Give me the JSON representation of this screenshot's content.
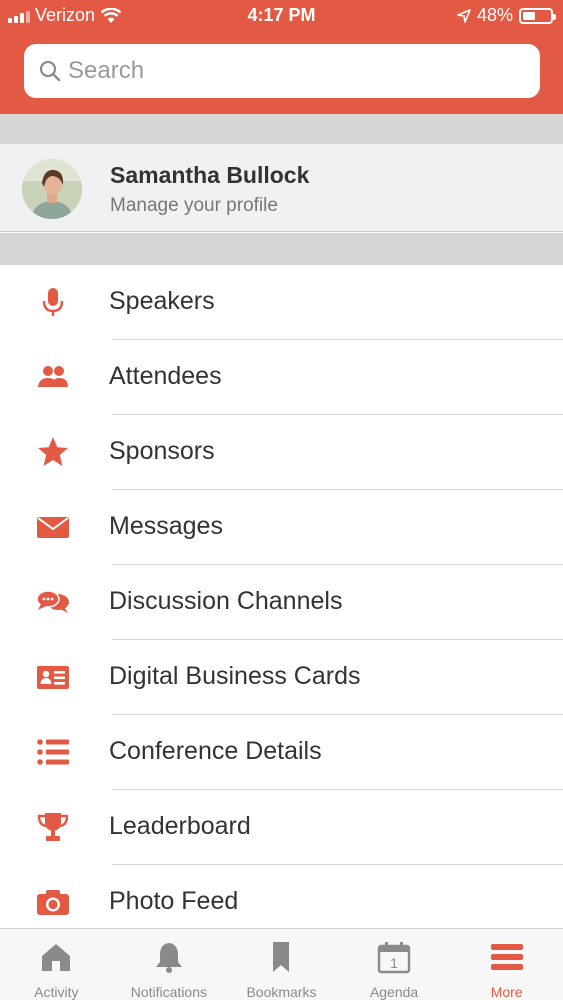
{
  "colors": {
    "accent": "#e25a43",
    "tab_inactive": "#8a8a8a",
    "text": "#333333"
  },
  "status_bar": {
    "carrier": "Verizon",
    "time": "4:17 PM",
    "battery": "48%",
    "battery_level": 0.48
  },
  "search": {
    "placeholder": "Search"
  },
  "profile": {
    "name": "Samantha Bullock",
    "subtitle": "Manage your profile"
  },
  "menu": {
    "items": [
      {
        "label": "Speakers",
        "icon": "microphone-icon"
      },
      {
        "label": "Attendees",
        "icon": "people-icon"
      },
      {
        "label": "Sponsors",
        "icon": "star-icon"
      },
      {
        "label": "Messages",
        "icon": "envelope-icon"
      },
      {
        "label": "Discussion Channels",
        "icon": "chat-bubbles-icon"
      },
      {
        "label": "Digital Business Cards",
        "icon": "id-card-icon"
      },
      {
        "label": "Conference Details",
        "icon": "list-icon"
      },
      {
        "label": "Leaderboard",
        "icon": "trophy-icon"
      },
      {
        "label": "Photo Feed",
        "icon": "camera-icon"
      }
    ]
  },
  "tabs": [
    {
      "label": "Activity",
      "icon": "home-icon",
      "active": false
    },
    {
      "label": "Notifications",
      "icon": "bell-icon",
      "active": false
    },
    {
      "label": "Bookmarks",
      "icon": "bookmark-icon",
      "active": false
    },
    {
      "label": "Agenda",
      "icon": "calendar-icon",
      "calendar_day": "1",
      "active": false
    },
    {
      "label": "More",
      "icon": "hamburger-menu-icon",
      "active": true
    }
  ]
}
